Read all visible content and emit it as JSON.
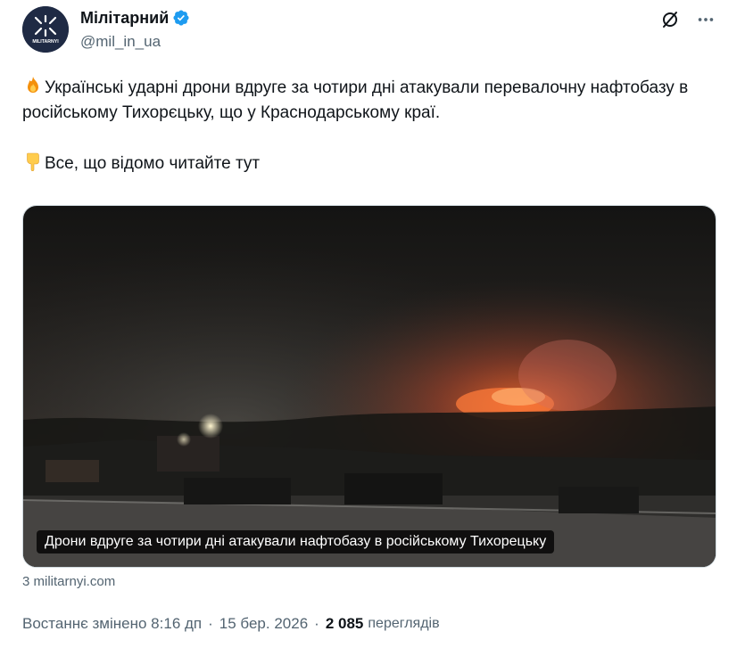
{
  "author": {
    "display_name": "Мілітарний",
    "handle": "@mil_in_ua",
    "avatar_text": "MILITARNYI",
    "verified_color": "#1d9bf0"
  },
  "actions": {
    "grok_icon": "grok-icon",
    "more_icon": "more-icon"
  },
  "tweet": {
    "line1_emoji": "fire-emoji",
    "line1": "Українські ударні дрони вдруге за чотири дні атакували перевалочну нафтобазу в російському Тихорєцьку, що у Краснодарському краї.",
    "line2_emoji": "pointing-down-emoji",
    "line2": "Все, що відомо читайте тут"
  },
  "media": {
    "caption": "Дрони вдруге за чотири дні атакували нафтобазу в російському Тихорецьку"
  },
  "link_source": "3 militarnyi.com",
  "meta": {
    "edited_label": "Востаннє змінено 8:16 дп",
    "separator": "·",
    "date": "15 бер. 2026",
    "views_count": "2 085",
    "views_label": "переглядів"
  },
  "colors": {
    "text_primary": "#0f1419",
    "text_secondary": "#536471",
    "fire": "#ff6a2a"
  }
}
